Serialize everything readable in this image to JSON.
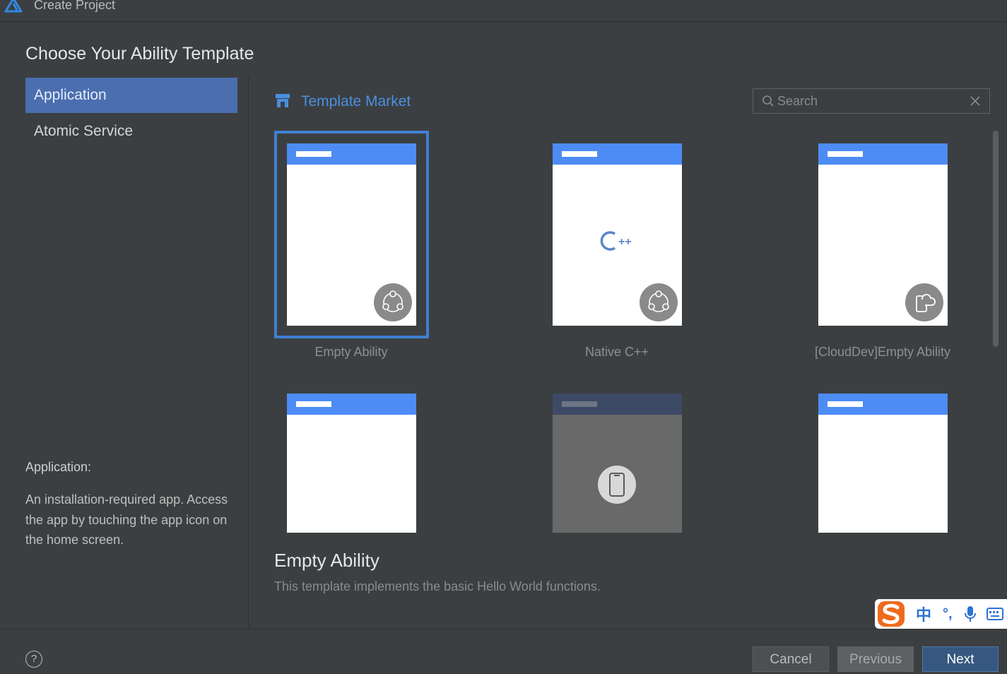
{
  "window": {
    "title": "Create Project"
  },
  "page": {
    "heading": "Choose Your Ability Template"
  },
  "sidebar": {
    "items": [
      {
        "label": "Application",
        "selected": true
      },
      {
        "label": "Atomic Service",
        "selected": false
      }
    ],
    "description_title": "Application:",
    "description_text": "An installation-required app. Access the app by touching the app icon on the home screen."
  },
  "market": {
    "label": "Template Market",
    "icon": "store-icon"
  },
  "search": {
    "placeholder": "Search",
    "value": ""
  },
  "templates": [
    {
      "label": "Empty Ability",
      "badge": "atomic-icon",
      "selected": true
    },
    {
      "label": "Native C++",
      "badge": "atomic-icon",
      "center": "cpp-icon"
    },
    {
      "label": "[CloudDev]Empty Ability",
      "badge": "cloud-phone-icon"
    },
    {
      "label": ""
    },
    {
      "label": "",
      "center": "phone-icon",
      "style": "gray"
    },
    {
      "label": ""
    }
  ],
  "selected_template": {
    "name": "Empty Ability",
    "description": "This template implements the basic Hello World functions."
  },
  "footer": {
    "help": "?",
    "cancel": "Cancel",
    "previous": "Previous",
    "next": "Next"
  },
  "ime": {
    "zh": "中",
    "punc": "°,"
  },
  "colors": {
    "background": "#3c3f41",
    "accent": "#4b6eaf",
    "card_header": "#4d8cf5",
    "link": "#4a90e2",
    "selected_border": "#3f7fd4"
  }
}
